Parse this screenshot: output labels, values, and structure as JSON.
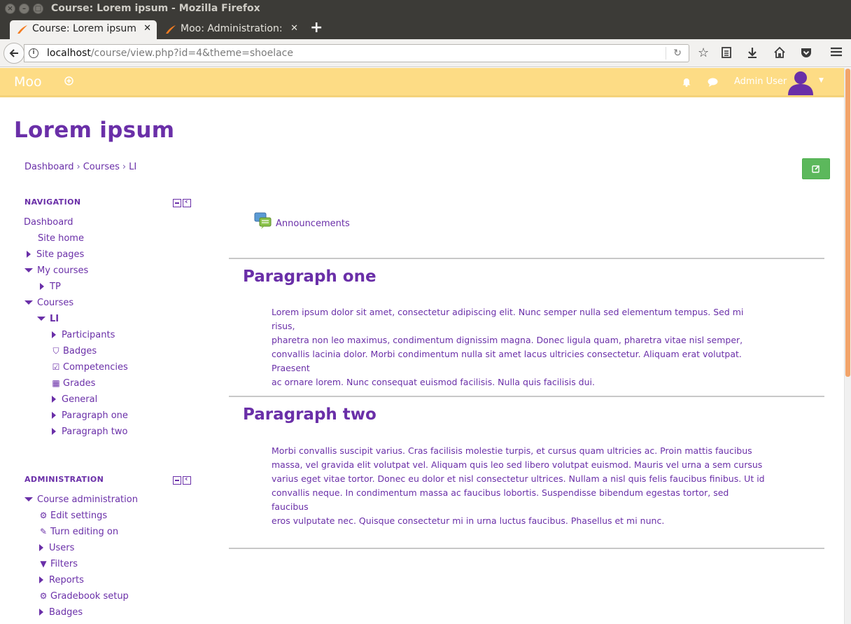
{
  "window": {
    "title": "Course: Lorem ipsum - Mozilla Firefox"
  },
  "tabs": [
    {
      "label": "Course: Lorem ipsum",
      "active": true
    },
    {
      "label": "Moo: Administration: ",
      "active": false
    }
  ],
  "browser": {
    "url_host": "localhost",
    "url_path": "/course/view.php?id=4&theme=shoelace"
  },
  "header": {
    "brand": "Moo",
    "user_name": "Admin User"
  },
  "page": {
    "title": "Lorem ipsum",
    "breadcrumb": [
      "Dashboard",
      "Courses",
      "LI"
    ]
  },
  "navigation": {
    "title": "NAVIGATION",
    "items": [
      {
        "label": "Dashboard"
      },
      {
        "label": "Site home"
      },
      {
        "label": "Site pages"
      },
      {
        "label": "My courses"
      },
      {
        "label": "TP"
      },
      {
        "label": "Courses"
      },
      {
        "label": "LI"
      },
      {
        "label": "Participants"
      },
      {
        "label": "Badges"
      },
      {
        "label": "Competencies"
      },
      {
        "label": "Grades"
      },
      {
        "label": "General"
      },
      {
        "label": "Paragraph one"
      },
      {
        "label": "Paragraph two"
      }
    ]
  },
  "administration": {
    "title": "ADMINISTRATION",
    "items": [
      {
        "label": "Course administration"
      },
      {
        "label": "Edit settings"
      },
      {
        "label": "Turn editing on"
      },
      {
        "label": "Users"
      },
      {
        "label": "Filters"
      },
      {
        "label": "Reports"
      },
      {
        "label": "Gradebook setup"
      },
      {
        "label": "Badges"
      }
    ]
  },
  "main": {
    "announcements": "Announcements",
    "sections": [
      {
        "title": "Paragraph one",
        "lines": [
          "Lorem ipsum dolor sit amet, consectetur adipiscing elit. Nunc semper nulla sed elementum tempus. Sed mi risus,",
          "pharetra non leo maximus, condimentum dignissim magna. Donec ligula quam, pharetra vitae nisl semper,",
          "convallis lacinia dolor. Morbi condimentum nulla sit amet lacus ultricies consectetur. Aliquam erat volutpat. Praesent",
          "ac ornare lorem. Nunc consequat euismod facilisis. Nulla quis facilisis dui."
        ]
      },
      {
        "title": "Paragraph two",
        "lines": [
          "Morbi convallis suscipit varius. Cras facilisis molestie turpis, et cursus quam ultricies ac. Proin mattis faucibus",
          "massa, vel gravida elit volutpat vel. Aliquam quis leo sed libero volutpat euismod. Mauris vel urna a sem cursus",
          "varius eget vitae tortor. Donec eu dolor et nisl consectetur ultrices. Nullam a nisl quis felis faucibus finibus. Ut id",
          "convallis neque. In condimentum massa ac faucibus lobortis. Suspendisse bibendum egestas tortor, sed faucibus",
          "eros vulputate nec. Quisque consectetur mi in urna luctus faucibus. Phasellus et mi nunc."
        ]
      }
    ]
  },
  "icons": {
    "brand_color": "#6a2fa8",
    "header_bg": "#fddc85",
    "edit_button_color": "#5cb85c"
  }
}
